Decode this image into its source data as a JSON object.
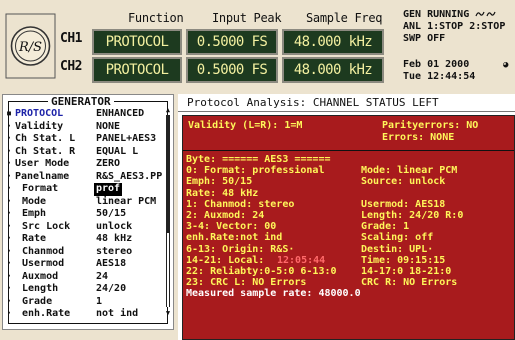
{
  "header": {
    "columns": {
      "function": "Function",
      "input_peak": "Input Peak",
      "sample_freq": "Sample Freq"
    },
    "channels": [
      {
        "label": "CH1",
        "function": "PROTOCOL",
        "input_peak": "0.5000 FS",
        "sample_freq": "48.000 kHz"
      },
      {
        "label": "CH2",
        "function": "PROTOCOL",
        "input_peak": "0.5000 FS",
        "sample_freq": "48.000 kHz"
      }
    ],
    "status": {
      "gen": "GEN RUNNING",
      "gen_icon": "oscillator-icon",
      "anl": "ANL 1:STOP 2:STOP",
      "swp": "SWP OFF"
    },
    "date": "Feb 01 2000",
    "time": "Tue 12:44:54",
    "time_icon": "clock-icon",
    "logo_text": "R/S"
  },
  "generator": {
    "title": "GENERATOR",
    "items": [
      {
        "bullet": "▪",
        "label": "PROTOCOL",
        "value": "ENHANCED",
        "active": true,
        "sub": false
      },
      {
        "bullet": "·",
        "label": "Validity",
        "value": "NONE",
        "sub": false
      },
      {
        "bullet": "·",
        "label": "Ch Stat. L",
        "value": "PANEL+AES3",
        "sub": false
      },
      {
        "bullet": "·",
        "label": "Ch Stat. R",
        "value": "EQUAL L",
        "sub": false
      },
      {
        "bullet": "·",
        "label": "User Mode",
        "value": "ZERO",
        "sub": false
      },
      {
        "bullet": "·",
        "label": "Panelname",
        "value": "R&S_AES3.PP",
        "sub": false
      },
      {
        "bullet": "·",
        "label": "Format",
        "value": "prof",
        "sub": true,
        "selected": true
      },
      {
        "bullet": "·",
        "label": "Mode",
        "value": "linear PCM",
        "sub": true
      },
      {
        "bullet": "·",
        "label": "Emph",
        "value": "50/15",
        "sub": true
      },
      {
        "bullet": "·",
        "label": "Src Lock",
        "value": "unlock",
        "sub": true
      },
      {
        "bullet": "·",
        "label": "Rate",
        "value": "48 kHz",
        "sub": true
      },
      {
        "bullet": "·",
        "label": "Chanmod",
        "value": "stereo",
        "sub": true
      },
      {
        "bullet": "·",
        "label": "Usermod",
        "value": "AES18",
        "sub": true
      },
      {
        "bullet": "·",
        "label": "Auxmod",
        "value": "24",
        "sub": true
      },
      {
        "bullet": "·",
        "label": "Length",
        "value": "24/20",
        "sub": true
      },
      {
        "bullet": "·",
        "label": "Grade",
        "value": "1",
        "sub": true
      },
      {
        "bullet": "·",
        "label": "enh.Rate",
        "value": "not ind",
        "sub": true
      }
    ],
    "scroll_up": "▲",
    "scroll_down": "▼"
  },
  "analysis": {
    "title": "Protocol Analysis: CHANNEL STATUS LEFT",
    "validity": "Validity (L=R): 1=M",
    "parity_errors": "Parityerrors: NO",
    "errors": "Errors:  NONE",
    "lines": [
      {
        "left": "Byte:     ======    AES3    ======"
      },
      {
        "left": "0:    Format:  professional",
        "right": "Mode:    linear PCM"
      },
      {
        "left": "      Emph:    50/15",
        "right": "Source:  unlock"
      },
      {
        "left": "      Rate:    48 kHz",
        "right": ""
      },
      {
        "left": "1:    Chanmod: stereo",
        "right": "Usermod: AES18"
      },
      {
        "left": "2:    Auxmod:  24",
        "right": "Length:  24/20 R:0"
      },
      {
        "left": "3-4:  Vector:  00",
        "right": "Grade:   1"
      },
      {
        "left": "      enh.Rate:not ind",
        "right": "Scaling: off"
      },
      {
        "left": "6-13: Origin:  R&S·",
        "right": "Destin:  UPL·"
      },
      {
        "left": "14-21: Local:  ",
        "local_time": "12:05:44",
        "right": "Time:    09:15:15"
      },
      {
        "left": "22:    Reliabty:0-5:0 6-13:0",
        "right": "14-17:0  18-21:0"
      },
      {
        "left": "23:    CRC L:   NO  Errors",
        "right": "CRC R:   NO  Errors"
      },
      {
        "left": "Measured sample rate:   48000.0",
        "white": true
      }
    ]
  }
}
